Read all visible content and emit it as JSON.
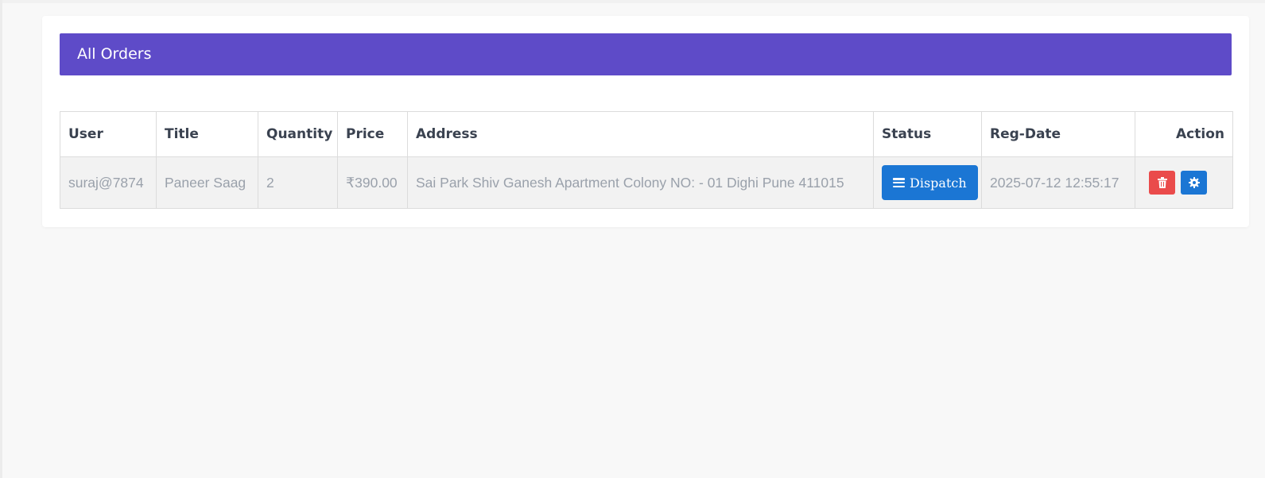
{
  "page": {
    "card_title": "All Orders"
  },
  "table": {
    "headers": {
      "user": "User",
      "title": "Title",
      "quantity": "Quantity",
      "price": "Price",
      "address": "Address",
      "status": "Status",
      "reg_date": "Reg-Date",
      "action": "Action"
    },
    "rows": [
      {
        "user": "suraj@7874",
        "title": "Paneer Saag",
        "quantity": "2",
        "price": "₹390.00",
        "address": "Sai Park Shiv Ganesh Apartment Colony NO: - 01 Dighi Pune 411015",
        "status_button": "Dispatch",
        "status_icon": "bars-icon",
        "reg_date": "2025-07-12 12:55:17",
        "actions": [
          {
            "icon": "trash-icon",
            "color": "#ea4b4b"
          },
          {
            "icon": "gear-icon",
            "color": "#1b76d4"
          }
        ]
      }
    ]
  },
  "colors": {
    "header_bg": "#5e4bc8",
    "primary_button": "#1b76d4",
    "danger_button": "#ea4b4b"
  }
}
